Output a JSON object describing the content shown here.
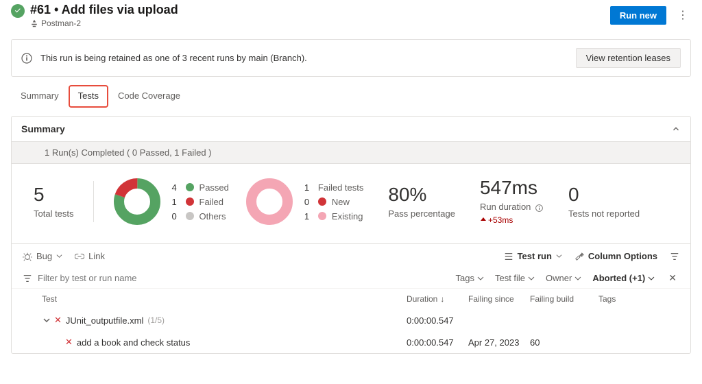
{
  "header": {
    "title": "#61 • Add files via upload",
    "pipeline": "Postman-2",
    "run_new": "Run new"
  },
  "info_bar": {
    "text": "This run is being retained as one of 3 recent runs by main (Branch).",
    "action": "View retention leases"
  },
  "tabs": {
    "summary": "Summary",
    "tests": "Tests",
    "coverage": "Code Coverage"
  },
  "panel": {
    "title": "Summary",
    "completed": "1 Run(s) Completed ( 0 Passed, 1 Failed )"
  },
  "stats": {
    "total_num": "5",
    "total_label": "Total tests",
    "breakdown": {
      "passed_n": "4",
      "passed": "Passed",
      "failed_n": "1",
      "failed": "Failed",
      "others_n": "0",
      "others": "Others"
    },
    "failed_tests": {
      "total_n": "1",
      "total": "Failed tests",
      "new_n": "0",
      "new": "New",
      "existing_n": "1",
      "existing": "Existing"
    },
    "pass_pct": "80%",
    "pass_label": "Pass percentage",
    "duration": "547ms",
    "duration_label": "Run duration",
    "duration_delta": "+53ms",
    "not_reported": "0",
    "not_reported_label": "Tests not reported"
  },
  "toolbar": {
    "bug": "Bug",
    "link": "Link",
    "test_run": "Test run",
    "column_options": "Column Options"
  },
  "filter": {
    "placeholder": "Filter by test or run name",
    "tags": "Tags",
    "test_file": "Test file",
    "owner": "Owner",
    "aborted": "Aborted (+1)"
  },
  "table": {
    "h_test": "Test",
    "h_duration": "Duration",
    "h_failing_since": "Failing since",
    "h_failing_build": "Failing build",
    "h_tags": "Tags",
    "rows": [
      {
        "name": "JUnit_outputfile.xml",
        "count": "(1/5)",
        "duration": "0:00:00.547",
        "failing_since": "",
        "failing_build": ""
      },
      {
        "name": "add a book and check status",
        "count": "",
        "duration": "0:00:00.547",
        "failing_since": "Apr 27, 2023",
        "failing_build": "60"
      }
    ]
  },
  "colors": {
    "green": "#55a362",
    "red": "#d13438",
    "grey": "#c8c6c4",
    "pink": "#f4a6b4"
  },
  "chart_data": [
    {
      "type": "pie",
      "title": "Test results",
      "series": [
        {
          "name": "Passed",
          "value": 4,
          "color": "#55a362"
        },
        {
          "name": "Failed",
          "value": 1,
          "color": "#d13438"
        },
        {
          "name": "Others",
          "value": 0,
          "color": "#c8c6c4"
        }
      ]
    },
    {
      "type": "pie",
      "title": "Failed tests",
      "series": [
        {
          "name": "New",
          "value": 0,
          "color": "#d13438"
        },
        {
          "name": "Existing",
          "value": 1,
          "color": "#f4a6b4"
        }
      ]
    }
  ]
}
